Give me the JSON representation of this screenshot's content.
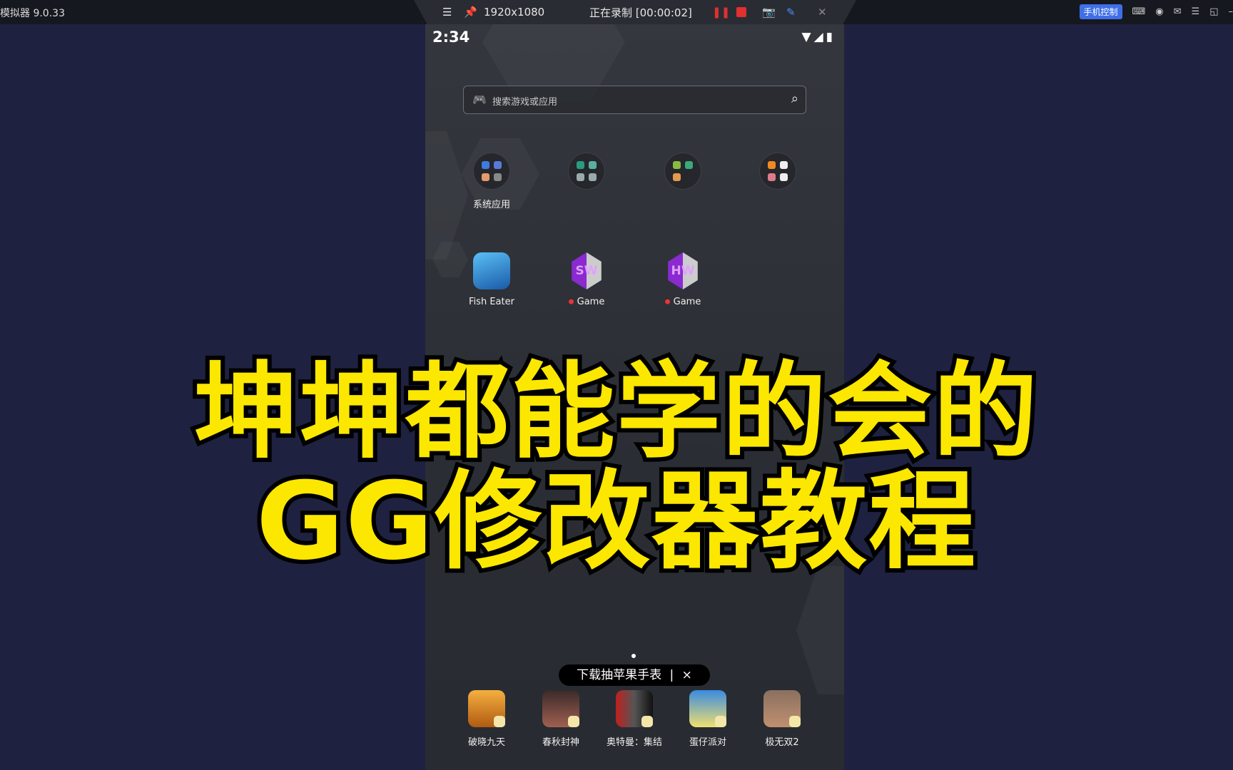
{
  "window": {
    "title": "模拟器 9.0.33"
  },
  "recorder": {
    "resolution": "1920x1080",
    "status": "正在录制 [00:00:02]",
    "menu_icon": "hamburger-icon",
    "pin_icon": "pin-icon",
    "pause_icon": "pause-icon",
    "stop_icon": "stop-icon",
    "camera_icon": "camera-icon",
    "pen_icon": "pen-icon",
    "close_icon": "close-icon",
    "pause_color": "#e03030"
  },
  "topright": {
    "phone_control": "手机控制",
    "accent": "#3f6fe8"
  },
  "status": {
    "time": "2:34"
  },
  "search": {
    "placeholder": "搜索游戏或应用"
  },
  "apps": [
    {
      "label": "系统应用",
      "type": "folder"
    },
    {
      "label": "",
      "type": "folder"
    },
    {
      "label": "",
      "type": "folder"
    },
    {
      "label": "",
      "type": "folder"
    },
    {
      "label": "Fish Eater",
      "type": "app"
    },
    {
      "label": "Game",
      "type": "app",
      "new": true
    },
    {
      "label": "Game",
      "type": "app",
      "new": true
    }
  ],
  "icon_letters": [
    "SW",
    "HW"
  ],
  "tooltip": {
    "text": "下载抽苹果手表",
    "sep": "|",
    "close": "×"
  },
  "dock": [
    {
      "label": "破晓九天"
    },
    {
      "label": "春秋封神"
    },
    {
      "label": "奥特曼：集结"
    },
    {
      "label": "蛋仔派对"
    },
    {
      "label": "极无双2"
    }
  ],
  "overlay": {
    "line1": "坤坤都能学的会的",
    "line2": "GG修改器教程",
    "color": "#fce700"
  }
}
